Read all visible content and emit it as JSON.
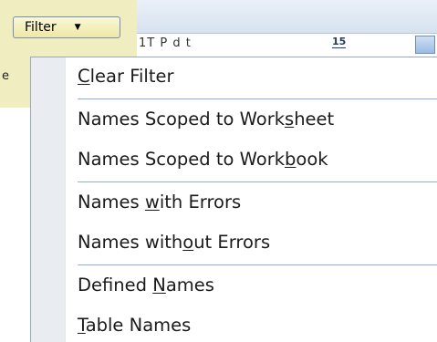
{
  "filter_button": {
    "label": "Filter"
  },
  "background": {
    "partial_text": "1T  P  d  t",
    "icon_15": "15",
    "left_char": "e"
  },
  "menu": {
    "items": [
      {
        "pre": "",
        "acc": "C",
        "post": "lear Filter"
      },
      {
        "pre": "Names Scoped to Work",
        "acc": "s",
        "post": "heet"
      },
      {
        "pre": "Names Scoped to Work",
        "acc": "b",
        "post": "ook"
      },
      {
        "pre": "Names ",
        "acc": "w",
        "post": "ith Errors"
      },
      {
        "pre": "Names with",
        "acc": "o",
        "post": "ut Errors"
      },
      {
        "pre": "Defined ",
        "acc": "N",
        "post": "ames"
      },
      {
        "pre": "",
        "acc": "T",
        "post": "able Names"
      }
    ]
  }
}
